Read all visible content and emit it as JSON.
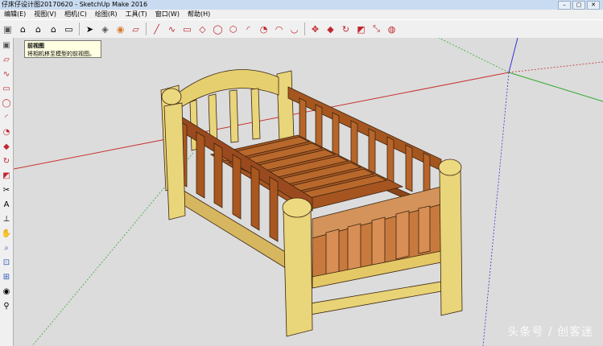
{
  "window": {
    "title": "仔床仔设计图20170620 - SketchUp Make 2016",
    "controls": [
      "–",
      "▢",
      "✕"
    ]
  },
  "menu": {
    "items": [
      "编辑(E)",
      "视图(V)",
      "相机(C)",
      "绘图(R)",
      "工具(T)",
      "窗口(W)",
      "帮助(H)"
    ]
  },
  "toolbar": {
    "icons": [
      "cube-icon",
      "home-icon",
      "house-front-icon",
      "house-back-icon",
      "house-side-icon",
      "select-arrow-icon",
      "component-icon",
      "paint-bucket-icon",
      "eraser-icon",
      "pencil-icon",
      "freehand-icon",
      "rectangle-icon",
      "rotated-rectangle-icon",
      "circle-icon",
      "polygon-icon",
      "arc-icon",
      "pie-icon",
      "arc3-icon",
      "arc-tangent-icon",
      "move-icon",
      "push-pull-icon",
      "rotate-icon",
      "follow-me-icon",
      "scale-icon",
      "offset-icon"
    ]
  },
  "tooltip": {
    "title": "前视图",
    "text": "将相机移至模型的前视图。"
  },
  "watermark": {
    "text": "头条号 / 创客迷"
  },
  "colors": {
    "axis_red": "#c83232",
    "axis_green": "#33aa33",
    "axis_blue": "#3333cc",
    "wood_light": "#e8d47a",
    "wood_dark": "#9a4a1e"
  }
}
